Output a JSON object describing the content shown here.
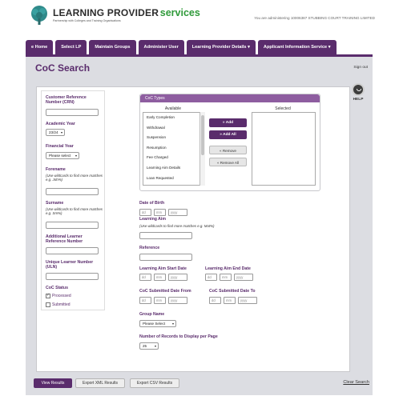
{
  "header": {
    "brand_a": "LEARNING PROVIDER",
    "brand_b": "services",
    "tagline": "Partnership with Colleges and Training Organisations",
    "admin_note": "You are administering 10006387 STUBBING COURT TRAINING LIMITED"
  },
  "nav": {
    "items": [
      "e Home",
      "Select LP",
      "Maintain Groups",
      "Administer User",
      "Learning Provider Details ▾",
      "Applicant Information Service ▾"
    ]
  },
  "page": {
    "title": "CoC Search",
    "signout": "Sign out",
    "help": "HELP"
  },
  "left": {
    "crn_label": "Customer Reference Number (CRN)",
    "ay_label": "Academic Year",
    "ay_value": "23/24",
    "fy_label": "Financial Year",
    "fy_value": "Please select",
    "forename_label": "Forename",
    "forename_hint": "(Use wildcards to find more matches e.g. Joh%)",
    "surname_label": "Surname",
    "surname_hint": "(Use wildcards to find more matches e.g. Sm%)",
    "alrn_label": "Additional Learner Reference Number",
    "uln_label": "Unique Learner Number (ULN)",
    "status_label": "CoC Status",
    "processed": "Processed",
    "submitted": "Submitted"
  },
  "coc": {
    "title": "CoC Types",
    "available": "Available",
    "selected": "Selected",
    "items": [
      "Early Completion",
      "Withdrawal",
      "Suspension",
      "Resumption",
      "Fee Charged",
      "Learning Aim Details",
      "Loan Requested"
    ],
    "add": "» Add",
    "add_all": "» Add All",
    "remove": "« Remove",
    "remove_all": "« Remove All"
  },
  "form": {
    "dob_label": "Date of Birth",
    "aim_label": "Learning Aim",
    "aim_hint": "(Use wildcards to find more matches e.g. Mat%)",
    "ref_label": "Reference",
    "aim_start_label": "Learning Aim Start Date",
    "aim_end_label": "Learning Aim End Date",
    "sub_from_label": "CoC Submitted Date From",
    "sub_to_label": "CoC Submitted Date To",
    "dd": "dd",
    "mm": "mm",
    "yyyy": "yyyy",
    "group_label": "Group Name",
    "group_value": "Please Select",
    "records_label": "Number of Records to Display per Page",
    "records_value": "25"
  },
  "footer": {
    "view": "View Results",
    "xml": "Export XML Results",
    "csv": "Export CSV Results",
    "clear": "Clear Search"
  },
  "colors": {
    "brand_purple": "#5a2c6c",
    "brand_green": "#2f9a3a",
    "header_purple_light": "#8e5da0"
  },
  "icons": {
    "logo": "tree-logo",
    "help": "help-icon"
  }
}
